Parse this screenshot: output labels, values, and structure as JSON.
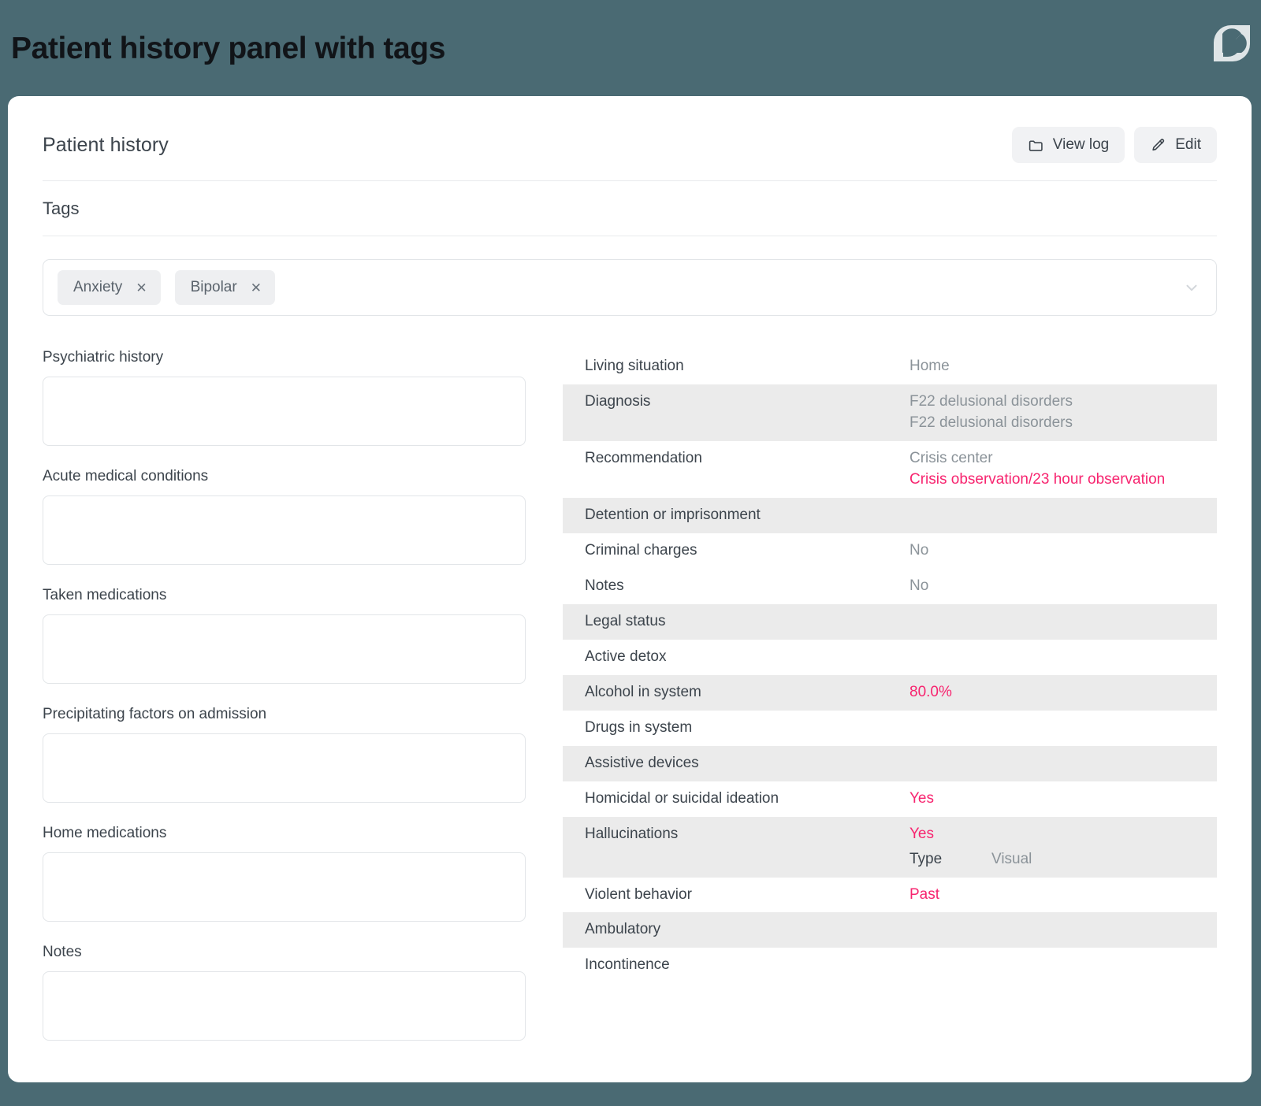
{
  "window": {
    "title": "Patient history panel with tags",
    "background_color": "#4a6a73",
    "logo_name": "leaf-logo"
  },
  "card": {
    "title": "Patient history",
    "actions": [
      {
        "label": "View log",
        "icon": "folder-icon"
      },
      {
        "label": "Edit",
        "icon": "pencil-icon"
      }
    ],
    "tags_section": {
      "label": "Tags",
      "chips": [
        {
          "label": "Anxiety",
          "remove": "✕"
        },
        {
          "label": "Bipolar",
          "remove": "✕"
        }
      ],
      "dropdown_icon": "chevron-down-icon"
    },
    "form_fields": [
      {
        "label": "Psychiatric history",
        "value": "",
        "placeholder": ""
      },
      {
        "label": "Acute medical conditions",
        "value": "",
        "placeholder": ""
      },
      {
        "label": "Taken medications",
        "value": "",
        "placeholder": ""
      },
      {
        "label": "Precipitating factors on admission",
        "value": "",
        "placeholder": ""
      },
      {
        "label": "Home medications",
        "value": "",
        "placeholder": ""
      },
      {
        "label": "Notes",
        "value": "",
        "placeholder": ""
      }
    ],
    "info_rows": [
      {
        "key": "Living situation",
        "values": [
          {
            "text": "Home",
            "alert": false
          }
        ],
        "striped": false
      },
      {
        "key": "Diagnosis",
        "values": [
          {
            "text": "F22 delusional disorders",
            "alert": false
          },
          {
            "text": "F22 delusional disorders",
            "alert": false
          }
        ],
        "striped": true
      },
      {
        "key": "Recommendation",
        "values": [
          {
            "text": "Crisis center",
            "alert": false
          },
          {
            "text": "Crisis observation/23 hour observation",
            "alert": true
          }
        ],
        "striped": false
      },
      {
        "key": "Detention or imprisonment",
        "values": [],
        "striped": true
      },
      {
        "key": "Criminal charges",
        "values": [
          {
            "text": "No",
            "alert": false
          }
        ],
        "striped": false
      },
      {
        "key": "Notes",
        "values": [
          {
            "text": "No",
            "alert": false
          }
        ],
        "striped": false
      },
      {
        "key": "Legal status",
        "values": [],
        "striped": true
      },
      {
        "key": "Active detox",
        "values": [],
        "striped": false
      },
      {
        "key": "Alcohol in system",
        "values": [
          {
            "text": "80.0%",
            "alert": true
          }
        ],
        "striped": true
      },
      {
        "key": "Drugs in system",
        "values": [],
        "striped": false
      },
      {
        "key": "Assistive devices",
        "values": [],
        "striped": true
      },
      {
        "key": "Homicidal or suicidal ideation",
        "values": [
          {
            "text": "Yes",
            "alert": true
          }
        ],
        "striped": false
      },
      {
        "key": "Hallucinations",
        "values": [
          {
            "text": "Yes",
            "alert": true
          }
        ],
        "sub": {
          "key": "Type",
          "value": "Visual"
        },
        "striped": true
      },
      {
        "key": "Violent behavior",
        "values": [
          {
            "text": "Past",
            "alert": true
          }
        ],
        "striped": false
      },
      {
        "key": "Ambulatory",
        "values": [],
        "striped": true
      },
      {
        "key": "Incontinence",
        "values": [],
        "striped": false
      }
    ]
  },
  "colors": {
    "page_background": "#4a6a73",
    "card_background": "#ffffff",
    "alert_text": "#f7246f",
    "stripe": "#ebebeb",
    "label_text": "#3c444c",
    "value_text": "#8b9399"
  }
}
